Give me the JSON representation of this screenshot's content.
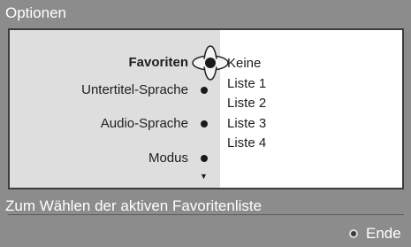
{
  "window": {
    "title": "Optionen"
  },
  "menu": {
    "items": [
      {
        "label": "Favoriten",
        "selected": true
      },
      {
        "label": "Untertitel-Sprache",
        "selected": false
      },
      {
        "label": "Audio-Sprache",
        "selected": false
      },
      {
        "label": "Modus",
        "selected": false
      }
    ],
    "icons": {
      "navigation": "nav-cross-icon",
      "scroll": "scroll-down-icon"
    }
  },
  "options": {
    "items": [
      "Keine",
      "Liste 1",
      "Liste 2",
      "Liste 3",
      "Liste 4"
    ]
  },
  "hint": {
    "text": "Zum Wählen der aktiven Favoritenliste"
  },
  "footer": {
    "end_label": "Ende",
    "end_icon": "circle-button-icon"
  },
  "colors": {
    "background": "#8c8c8c",
    "panel_left": "#dedede",
    "panel_right": "#ffffff",
    "text_light": "#ffffff",
    "text_dark": "#1e1e1e"
  }
}
